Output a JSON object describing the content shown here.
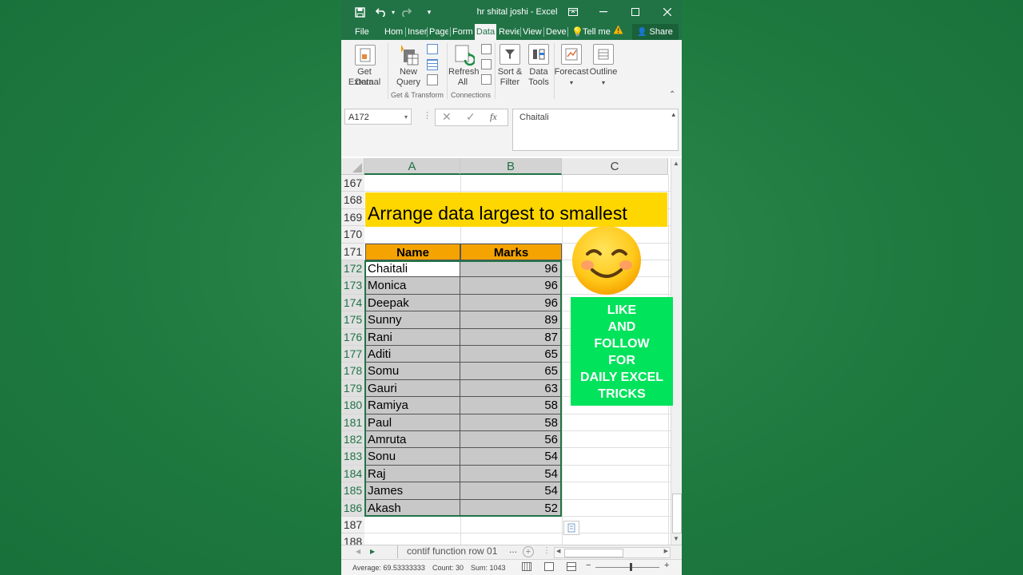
{
  "window": {
    "title": "hr shital joshi - Excel"
  },
  "tabs": [
    "File",
    "Hom",
    "Inser",
    "Page",
    "Form",
    "Data",
    "Revie",
    "View",
    "Deve"
  ],
  "active_tab": "Data",
  "tell_me": "Tell me",
  "share_label": "Share",
  "ribbon": {
    "get_external_1": "Get External",
    "get_external_2": "Data",
    "new_query_1": "New",
    "new_query_2": "Query",
    "refresh_1": "Refresh",
    "refresh_2": "All",
    "sort_filter_1": "Sort &",
    "sort_filter_2": "Filter",
    "data_tools_1": "Data",
    "data_tools_2": "Tools",
    "forecast": "Forecast",
    "outline": "Outline",
    "group_get_transform": "Get & Transform",
    "group_connections": "Connections"
  },
  "formula_bar": {
    "name_box": "A172",
    "fx": "fx",
    "content": "Chaitali"
  },
  "columns": [
    "A",
    "B",
    "C"
  ],
  "rows_top": [
    "167",
    "168",
    "169",
    "170",
    "171"
  ],
  "title_text": "Arrange data largest to smallest",
  "table": {
    "headers": [
      "Name",
      "Marks"
    ],
    "rows": [
      {
        "row": "172",
        "name": "Chaitali",
        "marks": "96"
      },
      {
        "row": "173",
        "name": "Monica",
        "marks": "96"
      },
      {
        "row": "174",
        "name": "Deepak",
        "marks": "96"
      },
      {
        "row": "175",
        "name": "Sunny",
        "marks": "89"
      },
      {
        "row": "176",
        "name": "Rani",
        "marks": "87"
      },
      {
        "row": "177",
        "name": "Aditi",
        "marks": "65"
      },
      {
        "row": "178",
        "name": "Somu",
        "marks": "65"
      },
      {
        "row": "179",
        "name": "Gauri",
        "marks": "63"
      },
      {
        "row": "180",
        "name": "Ramiya",
        "marks": "58"
      },
      {
        "row": "181",
        "name": "Paul",
        "marks": "58"
      },
      {
        "row": "182",
        "name": "Amruta",
        "marks": "56"
      },
      {
        "row": "183",
        "name": "Sonu",
        "marks": "54"
      },
      {
        "row": "184",
        "name": "Raj",
        "marks": "54"
      },
      {
        "row": "185",
        "name": "James",
        "marks": "54"
      },
      {
        "row": "186",
        "name": "Akash",
        "marks": "52"
      }
    ]
  },
  "rows_bottom": [
    "187",
    "188"
  ],
  "promo": [
    "LIKE",
    "AND",
    "FOLLOW",
    "FOR",
    "DAILY EXCEL",
    "TRICKS"
  ],
  "sheet_tab": "contif function row 01",
  "more": "...",
  "status": {
    "average": "Average: 69.53333333",
    "count": "Count: 30",
    "sum": "Sum: 1043"
  },
  "colors": {
    "excel_green": "#217346",
    "title_fill": "#ffd700",
    "header_fill": "#f5a300",
    "selection_fill": "#c8c8c8",
    "promo_fill": "#00e35b"
  }
}
